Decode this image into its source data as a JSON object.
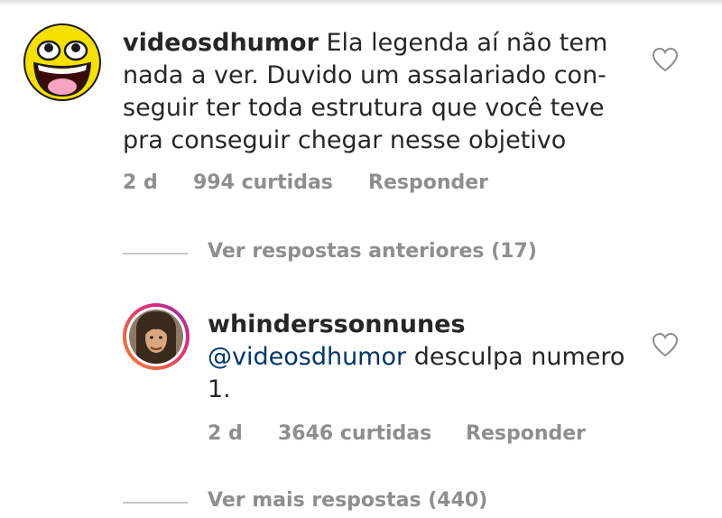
{
  "comments": [
    {
      "username": "videosdhumor",
      "text": "Ela legenda aí não tem nada a ver. Duvido um assalariado con-seguir ter toda estrutura que você teve pra conseguir chegar nesse objetivo",
      "lines": [
        " Ela legenda aí não tem",
        "nada a ver. Duvido um assalariado con-",
        "seguir ter toda estrutura que você teve",
        "pra conseguir chegar nesse objetivo"
      ],
      "time": "2 d",
      "likes": "994 curtidas",
      "reply_label": "Responder",
      "avatar_icon": "awesome-face-icon"
    },
    {
      "username": "whinderssonnunes",
      "mention": "@videosdhumor",
      "text_after_mention": " desculpa numero",
      "text_line2": "1.",
      "time": "2 d",
      "likes": "3646 curtidas",
      "reply_label": "Responder",
      "avatar_icon": "profile-photo-icon"
    }
  ],
  "view_previous_replies": "Ver respostas anteriores (17)",
  "view_more_replies": "Ver mais respostas (440)",
  "colors": {
    "text": "#262626",
    "meta": "#8e8e8e",
    "mention": "#003569",
    "story_ring_start": "#f58529",
    "story_ring_end": "#dd2a7b"
  }
}
